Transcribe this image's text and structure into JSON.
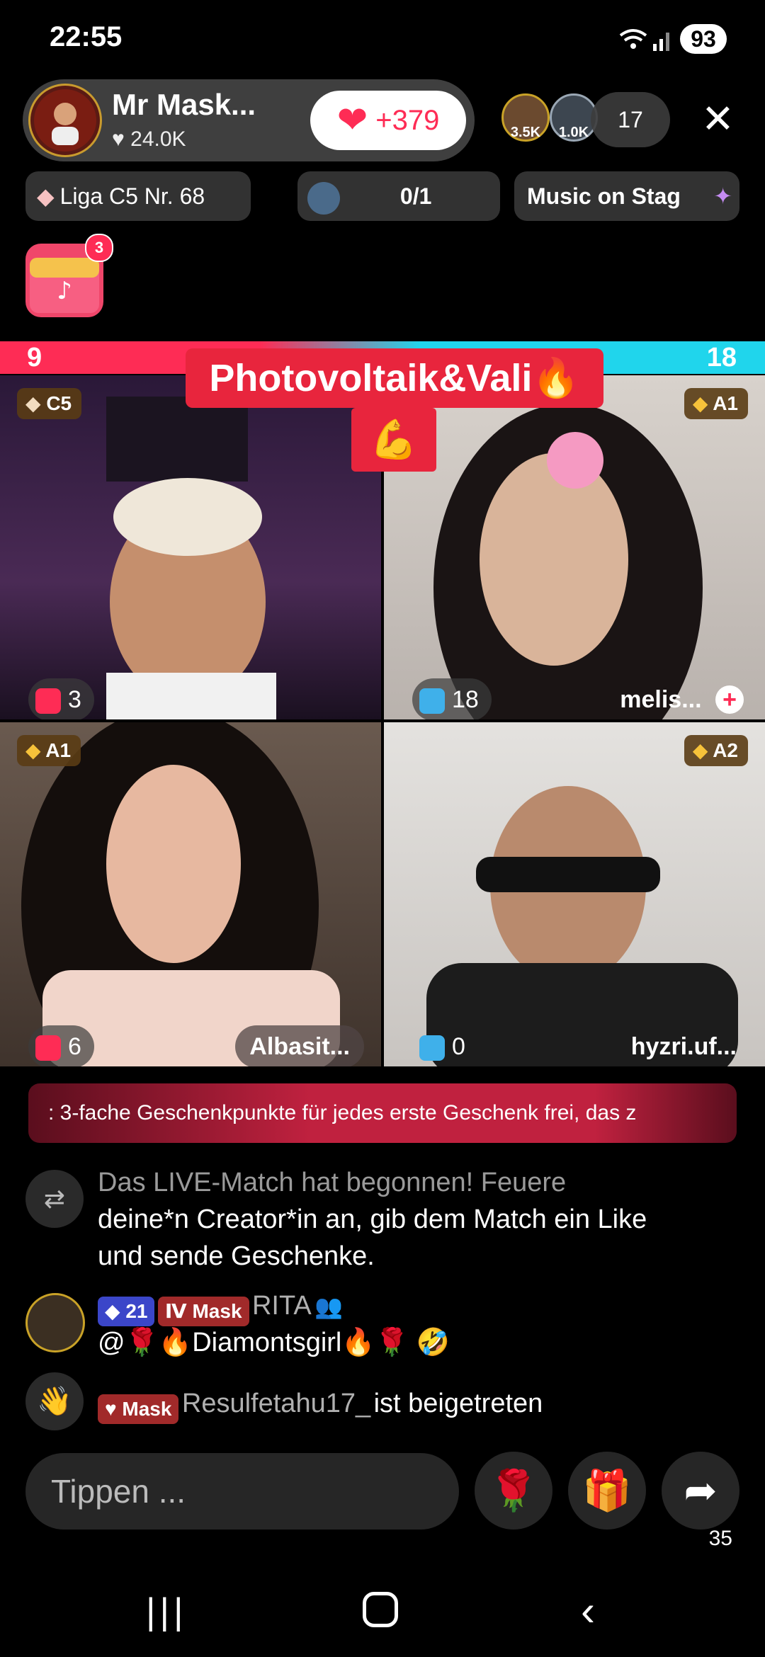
{
  "status": {
    "time": "22:55",
    "battery": "93"
  },
  "host": {
    "name": "Mr Mask...",
    "likes": "24.0K",
    "like_button": "+379"
  },
  "viewers": {
    "top": [
      "3.5K",
      "1.0K"
    ],
    "count": "17"
  },
  "chips": {
    "league": "Liga C5 Nr. 68",
    "goal": "0/1",
    "music": "Music on Stag"
  },
  "treasure_badge": "3",
  "match": {
    "left_score": "9",
    "right_score": "18",
    "banner_title": "Photovoltaik&Vali🔥",
    "banner_emoji": "💪"
  },
  "tiles": [
    {
      "rank": "C5",
      "score": "3",
      "name": ""
    },
    {
      "rank": "A1",
      "score": "18",
      "name": "melis..."
    },
    {
      "rank": "A1",
      "score": "6",
      "name": "Albasit..."
    },
    {
      "rank": "A2",
      "score": "0",
      "name": "hyzri.uf..."
    }
  ],
  "ticker": ": 3-fache Geschenkpunkte für jedes erste Geschenk frei, das z",
  "chat": {
    "system_line1": "Das LIVE-Match hat begonnen! Feuere",
    "system_line2": "deine*n Creator*in an, gib dem Match ein Like",
    "system_line3": "und sende Geschenke.",
    "msg1_level": "21",
    "msg1_badge": "Mask",
    "msg1_user": "RITA",
    "msg1_text": "@🌹🔥Diamontsgirl🔥🌹 🤣",
    "join_badge": "Mask",
    "join_user": "Resulfetahu17_",
    "join_text": "ist beigetreten"
  },
  "input": {
    "placeholder": "Tippen ..."
  },
  "share_count": "35",
  "colors": {
    "accent": "#fe2c55",
    "blue": "#20d5ec"
  }
}
